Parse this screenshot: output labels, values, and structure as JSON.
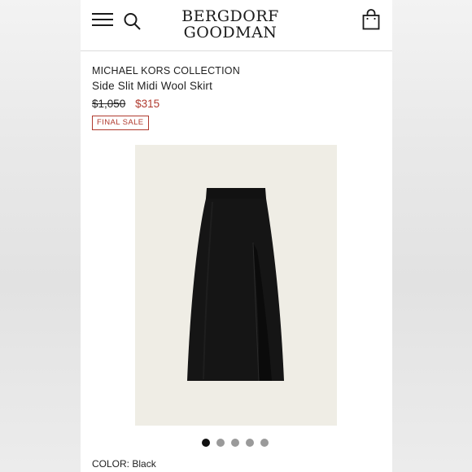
{
  "header": {
    "logo_line1": "BERGDORF",
    "logo_line2": "GOODMAN",
    "menu_icon": "hamburger-icon",
    "search_icon": "search-icon",
    "bag_icon": "shopping-bag-icon"
  },
  "product": {
    "brand": "MICHAEL KORS COLLECTION",
    "name": "Side Slit Midi Wool Skirt",
    "original_price": "$1,050",
    "sale_price": "$315",
    "badge": "FINAL SALE",
    "color_label": "COLOR:",
    "color_value": "Black",
    "image_description_icon": "skirt-image"
  },
  "carousel": {
    "total": 5,
    "active_index": 0
  },
  "colors": {
    "sale_red": "#b03a2e",
    "image_bg": "#efede5",
    "skirt": "#141414"
  }
}
